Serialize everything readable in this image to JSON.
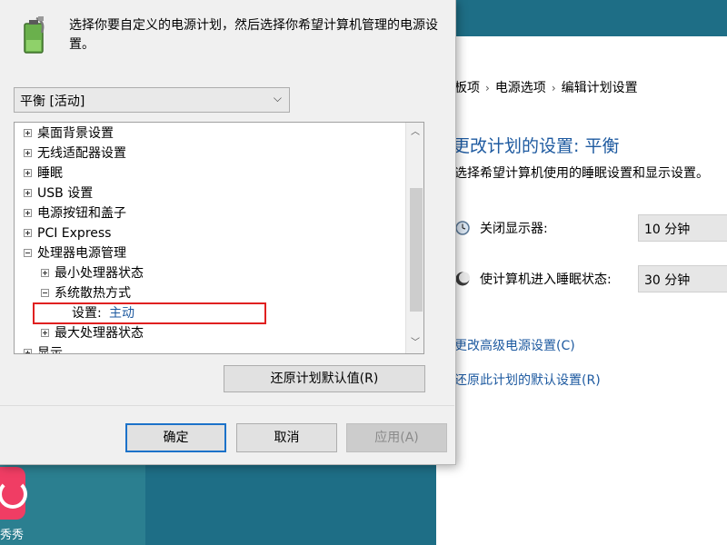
{
  "desktop": {
    "app_label": "秀秀"
  },
  "control_panel": {
    "breadcrumb": [
      "板项",
      "电源选项",
      "编辑计划设置"
    ],
    "title": "更改计划的设置: 平衡",
    "description": "选择希望计算机使用的睡眠设置和显示设置。",
    "display_off_label": "关闭显示器:",
    "display_off_value": "10 分钟",
    "sleep_label": "使计算机进入睡眠状态:",
    "sleep_value": "30 分钟",
    "advanced_link": "更改高级电源设置(C)",
    "restore_link": "还原此计划的默认设置(R)"
  },
  "dialog": {
    "instructions": "选择你要自定义的电源计划，然后选择你希望计算机管理的电源设置。",
    "plan_selected": "平衡 [活动]",
    "tree": [
      {
        "label": "桌面背景设置"
      },
      {
        "label": "无线适配器设置"
      },
      {
        "label": "睡眠"
      },
      {
        "label": "USB 设置"
      },
      {
        "label": "电源按钮和盖子"
      },
      {
        "label": "PCI Express"
      },
      {
        "label": "处理器电源管理"
      },
      {
        "label": "最小处理器状态"
      },
      {
        "label": "系统散热方式"
      },
      {
        "label": "设置:",
        "value": "主动"
      },
      {
        "label": "最大处理器状态"
      },
      {
        "label": "显示"
      }
    ],
    "restore_defaults_button": "还原计划默认值(R)",
    "ok_button": "确定",
    "cancel_button": "取消",
    "apply_button": "应用(A)"
  },
  "colors": {
    "link_blue": "#1e5aa0",
    "highlight_red": "#e02020",
    "primary_border": "#1c72c9"
  }
}
